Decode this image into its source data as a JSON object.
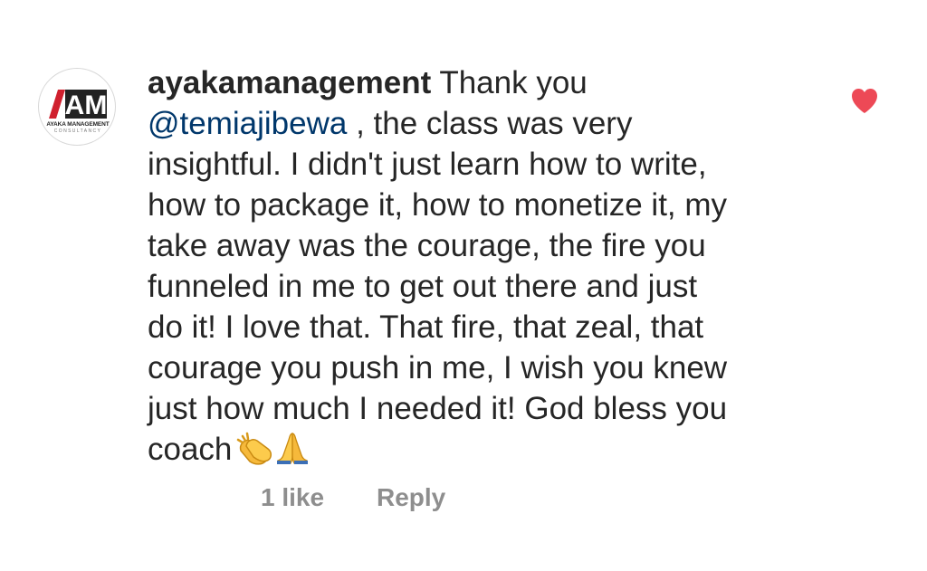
{
  "comment": {
    "author": {
      "username": "ayakamanagement",
      "avatar": {
        "logo_text": "AM",
        "brand_name": "AYAKA MANAGEMENT",
        "brand_subtitle": "CONSULTANCY"
      }
    },
    "text": {
      "line1_after_username": " Thank you",
      "mention": "@temiajibewa",
      "line2_after_mention": " , the class was very",
      "lines": [
        "insightful. I didn't just learn how to write,",
        "how to package it, how to monetize it, my",
        "take away was the courage, the fire you",
        "funneled in me to get out there and just",
        "do it! I love that. That fire, that zeal, that",
        "courage you push in me, I wish you knew",
        "just how much I needed it! God bless you"
      ],
      "last_line": "coach",
      "emojis": [
        "clapping-hands-emoji",
        "folded-hands-emoji"
      ]
    },
    "liked": true,
    "like_icon": "heart-icon",
    "like_color": "#ed4956",
    "actions": {
      "likes_label": "1 like",
      "reply_label": "Reply"
    }
  },
  "colors": {
    "text": "#262626",
    "mention": "#00376b",
    "secondary": "#8e8e8e",
    "logo_red": "#d0202e",
    "logo_dark": "#222222"
  }
}
